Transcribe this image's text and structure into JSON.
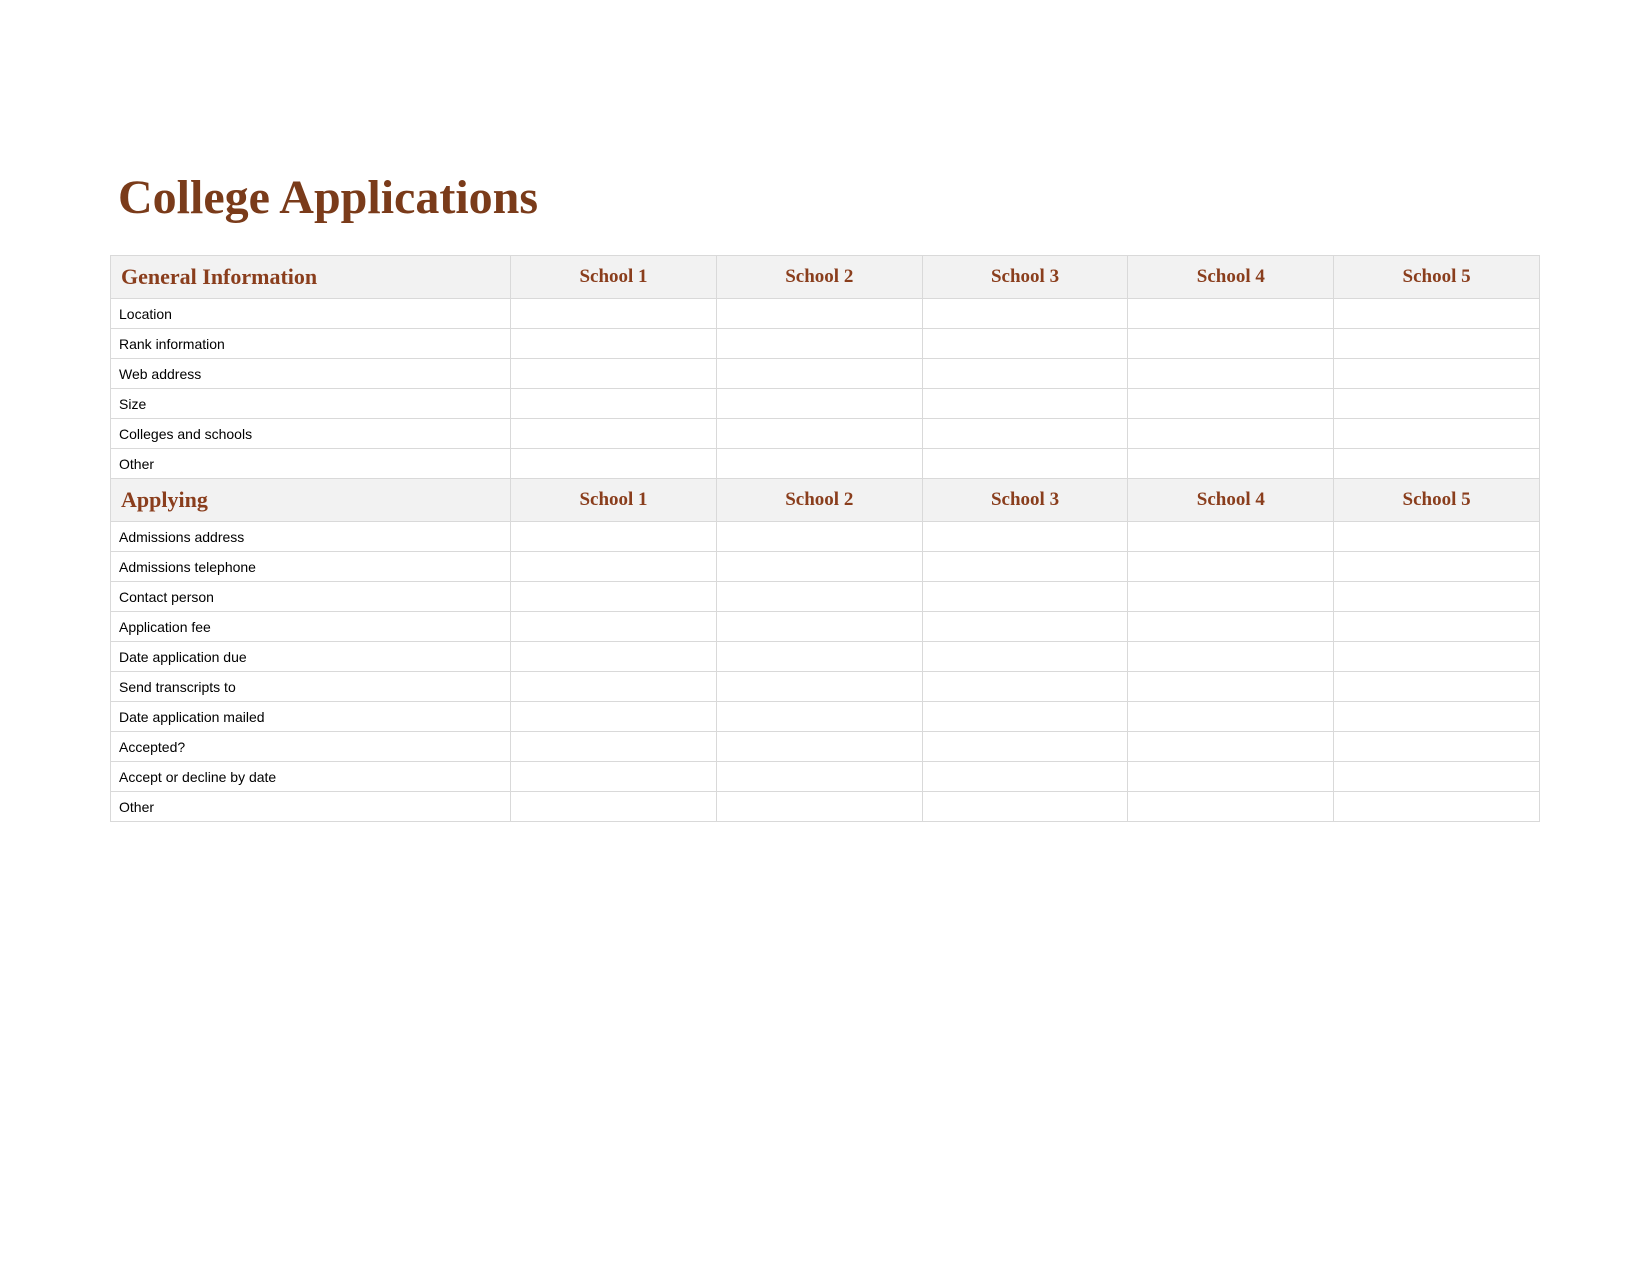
{
  "title": "College Applications",
  "schools": [
    "School 1",
    "School 2",
    "School 3",
    "School 4",
    "School 5"
  ],
  "sections": [
    {
      "name": "General Information",
      "rows": [
        "Location",
        "Rank information",
        "Web address",
        "Size",
        "Colleges and schools",
        "Other"
      ]
    },
    {
      "name": "Applying",
      "rows": [
        "Admissions address",
        "Admissions telephone",
        "Contact person",
        "Application fee",
        "Date application due",
        "Send transcripts to",
        "Date application mailed",
        "Accepted?",
        "Accept or decline by date",
        "Other"
      ]
    }
  ]
}
